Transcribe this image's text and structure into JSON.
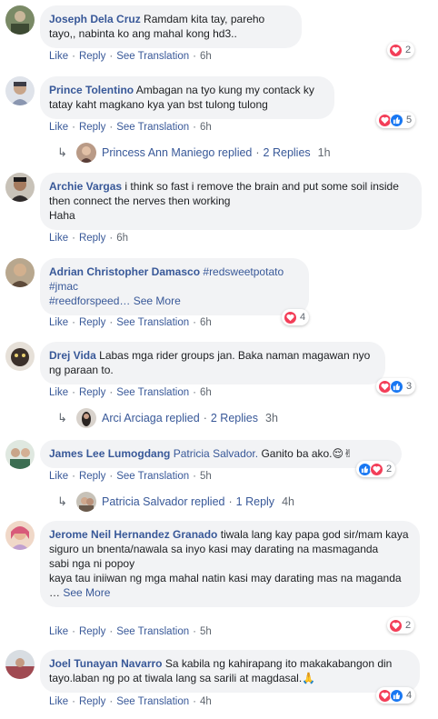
{
  "actions": {
    "like": "Like",
    "reply": "Reply",
    "see_translation": "See Translation",
    "separator": "·"
  },
  "comments": [
    {
      "author": "Joseph Dela Cruz",
      "text": "Ramdam kita tay, pareho tayo,, nabinta ko ang mahal kong hd3..",
      "time": "6h",
      "reaction_count": "2",
      "avatar_color": "#6b7b5a"
    },
    {
      "author": "Prince Tolentino",
      "text": "Ambagan na tyo kung my contack ky tatay kaht magkano kya yan bst tulong tulong",
      "time": "6h",
      "reaction_count": "5",
      "avatar_color": "#7d8aa0",
      "replies": {
        "who": "Princess Ann Maniego replied",
        "count": "2 Replies",
        "time": "1h"
      }
    },
    {
      "author": "Archie Vargas",
      "text": "i think so fast i remove the brain and put some soil inside then connect the nerves then working\nHaha",
      "time": "6h",
      "avatar_color": "#8a6a58"
    },
    {
      "author": "Adrian Christopher Damasco",
      "mention": "#redsweetpotato",
      "text": "#jmac\n#reedforspeed…",
      "see_more": "See More",
      "time": "6h",
      "reaction_count": "4",
      "avatar_color": "#9a8870"
    },
    {
      "author": "Drej Vida",
      "text": "Labas mga rider groups jan. Baka naman magawan nyo ng paraan to.",
      "time": "6h",
      "reaction_count": "3",
      "avatar_color": "#3e3530",
      "replies": {
        "who": "Arci Arciaga replied",
        "count": "2 Replies",
        "time": "3h"
      }
    },
    {
      "author": "James Lee Lumogdang",
      "mention": "Patricia Salvador.",
      "text": "Ganito ba ako.😌✌",
      "time": "5h",
      "reaction_count": "2",
      "avatar_color": "#4b6e58",
      "replies": {
        "who": "Patricia Salvador replied",
        "count": "1 Reply",
        "time": "4h"
      }
    },
    {
      "author": "Jerome Neil Hernandez Granado",
      "text": "tiwala lang kay papa god sir/mam kaya siguro un bnenta/nawala sa inyo kasi may darating na masmaganda\nsabi nga ni popoy\nkaya tau iniiwan ng mga mahal natin kasi may darating mas na maganda …",
      "see_more": "See More",
      "time": "5h",
      "reaction_count": "2",
      "avatar_color": "#d9a88c"
    },
    {
      "author": "Joel Tunayan Navarro",
      "text": "Sa kabila ng kahirapang ito makakabangon din tayo.laban ng po at tiwala lang sa sarili at magdasal.🙏",
      "time": "4h",
      "reaction_count": "4",
      "avatar_color": "#a0505a"
    }
  ],
  "colors": {
    "link": "#385898",
    "bubble": "#f2f3f5",
    "love": "#f33e58",
    "like": "#1877f2"
  }
}
